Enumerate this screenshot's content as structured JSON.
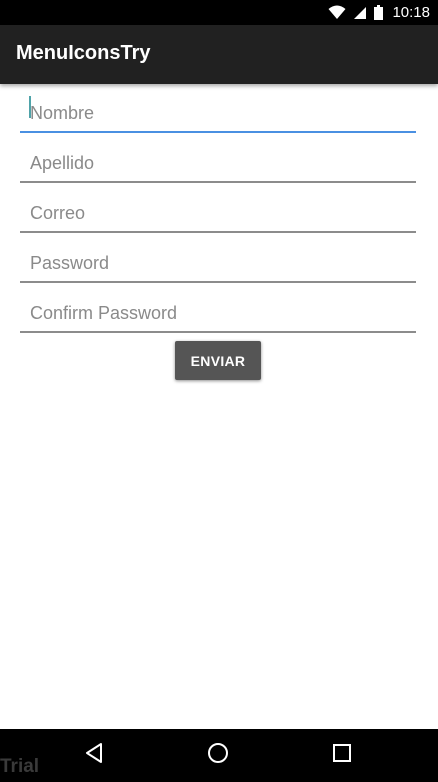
{
  "status_bar": {
    "time": "10:18",
    "icons": [
      "wifi-icon",
      "signal-icon",
      "battery-icon"
    ]
  },
  "app_bar": {
    "title": "MenuIconsTry",
    "background_color": "#212121"
  },
  "form": {
    "fields": [
      {
        "name": "nombre",
        "placeholder": "Nombre",
        "value": "",
        "focused": true
      },
      {
        "name": "apellido",
        "placeholder": "Apellido",
        "value": ""
      },
      {
        "name": "correo",
        "placeholder": "Correo",
        "value": ""
      },
      {
        "name": "password",
        "placeholder": "Password",
        "value": ""
      },
      {
        "name": "confirm-password",
        "placeholder": "Confirm Password",
        "value": ""
      }
    ],
    "submit_label": "ENVIAR",
    "focus_color": "#4a90e2"
  },
  "nav_bar": {
    "icons": [
      "back-icon",
      "home-icon",
      "recents-icon"
    ]
  },
  "watermark": {
    "text": "Trial"
  }
}
